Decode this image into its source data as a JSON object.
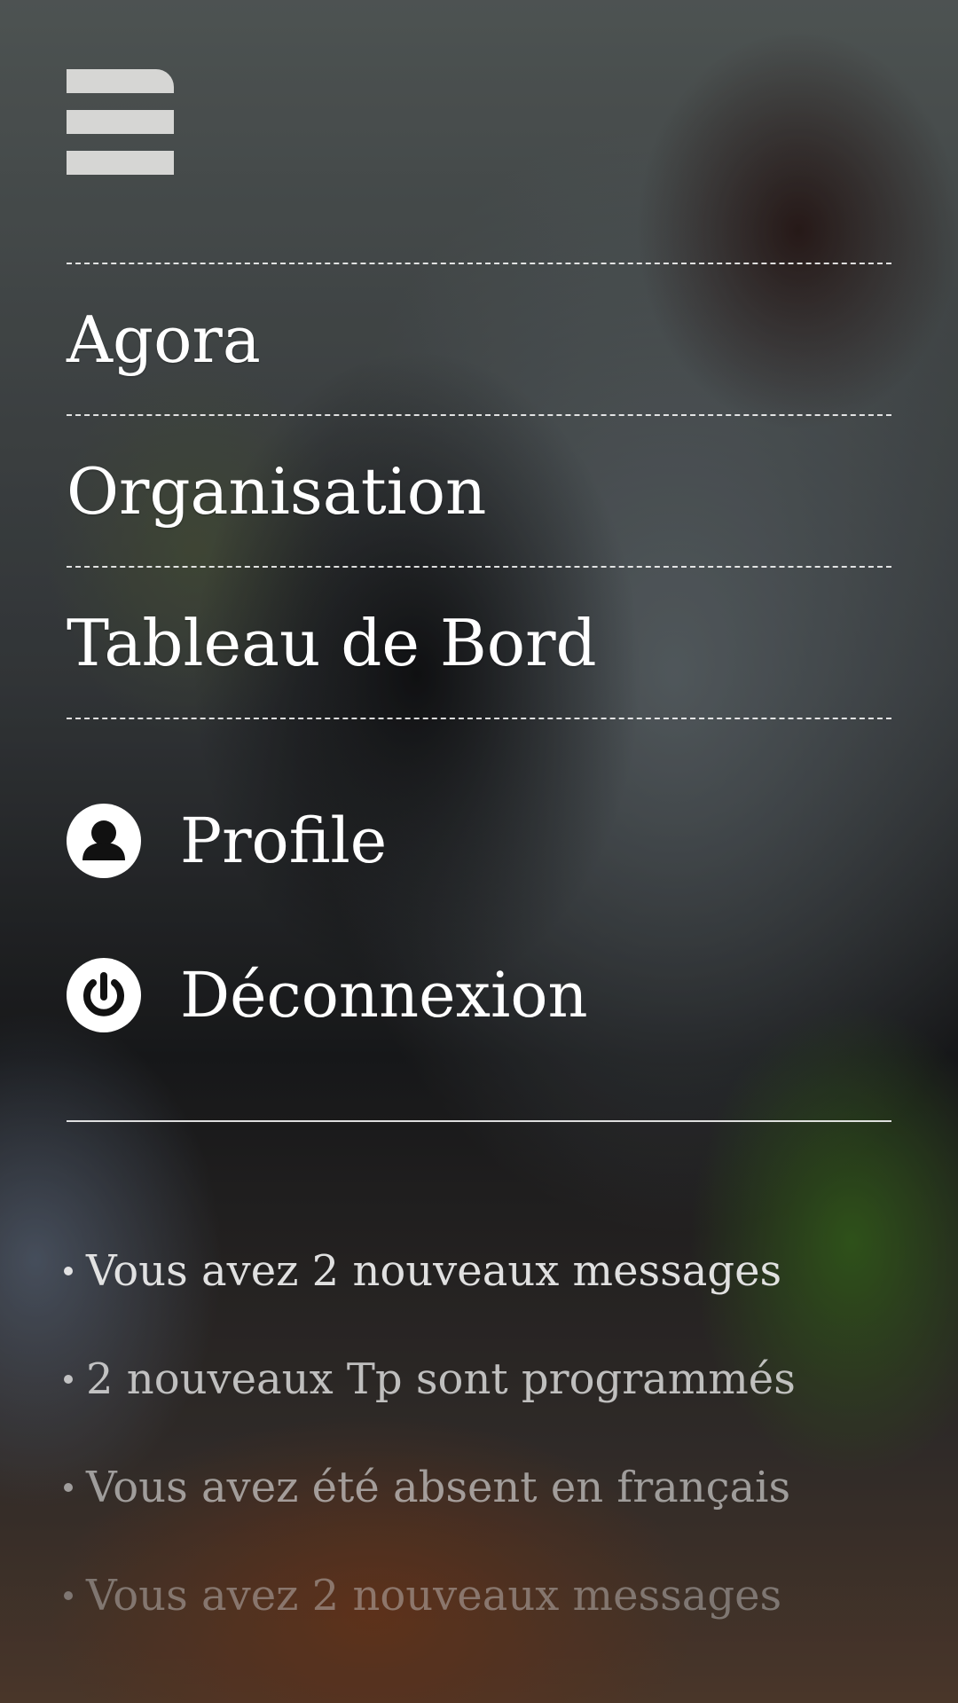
{
  "menu": {
    "items": [
      {
        "label": "Agora"
      },
      {
        "label": "Organisation"
      },
      {
        "label": "Tableau de Bord"
      }
    ]
  },
  "account": {
    "profile_label": "Profile",
    "profile_icon": "user-icon",
    "logout_label": "Déconnexion",
    "logout_icon": "power-icon"
  },
  "notifications": [
    {
      "text": "Vous avez 2 nouveaux messages"
    },
    {
      "text": "2 nouveaux Tp sont programmés"
    },
    {
      "text": "Vous avez été absent en français"
    },
    {
      "text": "Vous avez 2 nouveaux messages"
    }
  ],
  "colors": {
    "text": "#ffffff",
    "menu_icon": "#d6d6d4",
    "divider": "#ffffff"
  }
}
